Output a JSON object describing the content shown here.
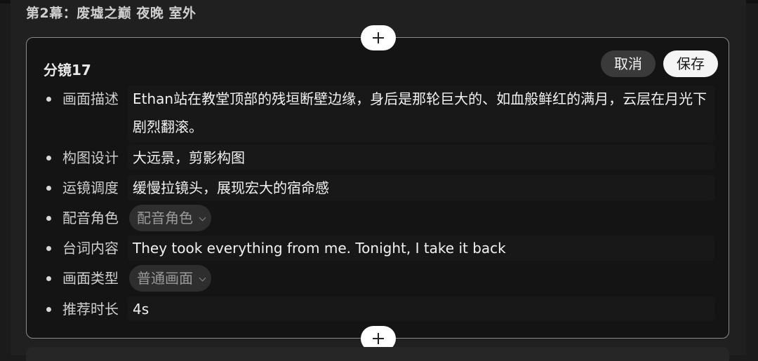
{
  "scene": {
    "title": "第2幕：废墟之巅 夜晚 室外"
  },
  "shot": {
    "title": "分镜17",
    "cancel_label": "取消",
    "save_label": "保存",
    "fields": [
      {
        "label": "画面描述",
        "value": "Ethan站在教堂顶部的残垣断壁边缘，身后是那轮巨大的、如血般鲜红的满月，云层在月光下剧烈翻滚。"
      },
      {
        "label": "构图设计",
        "value": "大远景，剪影构图"
      },
      {
        "label": "运镜调度",
        "value": "缓慢拉镜头，展现宏大的宿命感"
      },
      {
        "label": "配音角色",
        "value": "配音角色"
      },
      {
        "label": "台词内容",
        "value": "They took everything from me. Tonight, I take it back"
      },
      {
        "label": "画面类型",
        "value": "普通画面"
      },
      {
        "label": "推荐时长",
        "value": "4s"
      }
    ]
  },
  "icons": {
    "add": "plus-icon",
    "dropdown": "chevron-down-icon"
  },
  "colors": {
    "background": "#202020",
    "card": "#141414",
    "card_border": "#8a8a8a",
    "save_button": "#f5f5f5",
    "cancel_button": "#3a3a3a"
  }
}
